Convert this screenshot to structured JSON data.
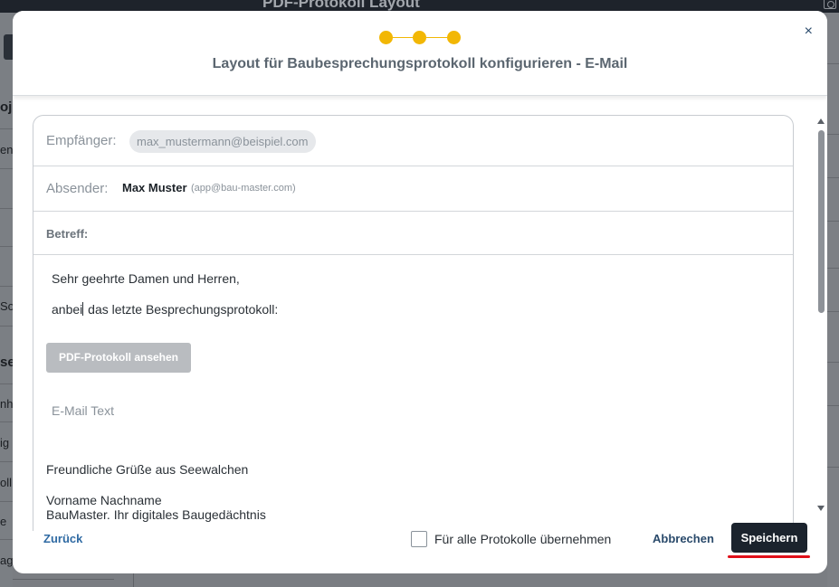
{
  "background": {
    "window_title": "PDF-Protokoll Layout",
    "left_fragments": [
      "oje",
      "en",
      "So",
      "se",
      "nh",
      "ig",
      "oll",
      "e",
      "ag"
    ]
  },
  "modal": {
    "title": "Layout für Baubesprechungsprotokoll konfigurieren - E-Mail",
    "stepper": {
      "total_steps": 3,
      "accent_color": "#f2b705"
    },
    "close_label": "×",
    "email": {
      "recipient_label": "Empfänger:",
      "recipient_value": "max_mustermann@beispiel.com",
      "sender_label": "Absender:",
      "sender_name": "Max Muster",
      "sender_email": "(app@bau-master.com)",
      "subject_label": "Betreff:",
      "subject_value": "",
      "body": {
        "salutation": "Sehr geehrte Damen und Herren,",
        "intro_before_caret": "anbei",
        "intro_after_caret": " das letzte Besprechungsprotokoll:",
        "pdf_button_label": "PDF-Protokoll ansehen",
        "text_placeholder": "E-Mail Text",
        "closing": "Freundliche Grüße aus Seewalchen",
        "signature_name": "Vorname Nachname",
        "signature_company": "BauMaster. Ihr digitales Baugedächtnis"
      }
    },
    "footer": {
      "back_label": "Zurück",
      "apply_all_label": "Für alle Protokolle übernehmen",
      "apply_all_checked": false,
      "cancel_label": "Abbrechen",
      "save_label": "Speichern",
      "save_highlight_color": "#e0101a"
    }
  }
}
